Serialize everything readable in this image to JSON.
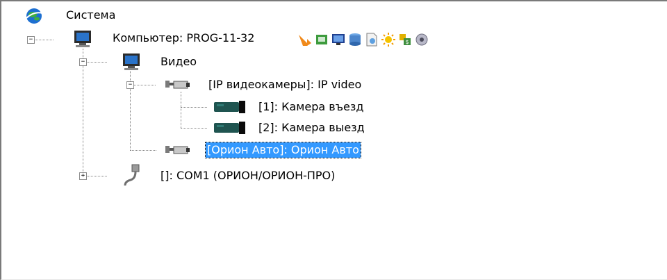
{
  "tree": {
    "root": {
      "label": "Система",
      "icon": "globe-icon"
    },
    "computer": {
      "label": "Компьютер: PROG-11-32",
      "expanded": true,
      "toolbar_icons": [
        "arrow-icon",
        "folder-icon",
        "monitor-icon",
        "database-icon",
        "document-icon",
        "sun-icon",
        "tools-icon",
        "settings-icon"
      ]
    },
    "video": {
      "label": "Видео",
      "expanded": true
    },
    "ip_cameras": {
      "label": "[IP видеокамеры]: IP video",
      "expanded": true
    },
    "camera1": {
      "label": "[1]: Камера въезд"
    },
    "camera2": {
      "label": "[2]: Камера выезд"
    },
    "orion_auto": {
      "label": "[Орион Авто]: Орион Авто",
      "selected": true
    },
    "com1": {
      "label": "[]: COM1 (ОРИОН/ОРИОН-ПРО)",
      "expanded": false
    }
  },
  "colors": {
    "selection": "#3399ff",
    "lines": "#808080"
  },
  "glyphs": {
    "minus": "−",
    "plus": "+"
  }
}
